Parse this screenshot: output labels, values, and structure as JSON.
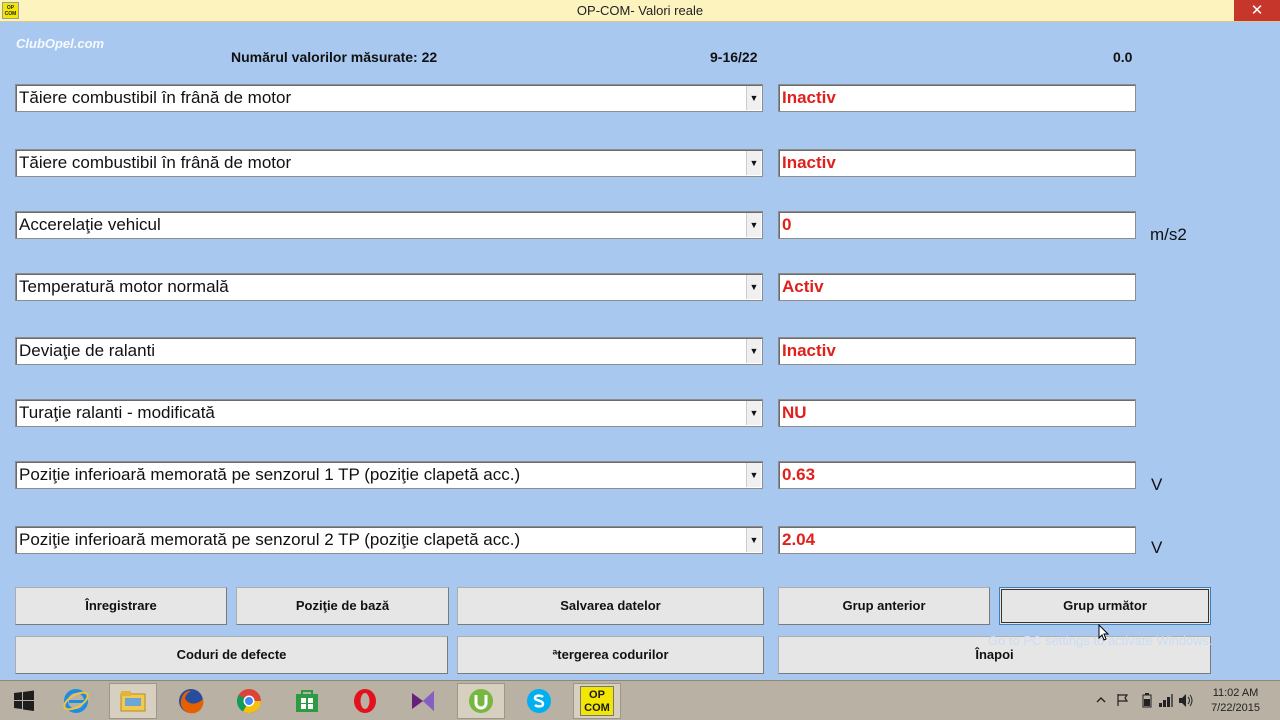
{
  "window": {
    "title": "OP-COM- Valori reale",
    "watermark": "ClubOpel.com",
    "close_glyph": "✕",
    "app_icon_text": "OP COM"
  },
  "header": {
    "count_label": "Numărul valorilor măsurate: 22",
    "range": "9-16/22",
    "value": "0.0"
  },
  "rows": [
    {
      "param": "Tăiere combustibil în frână de motor",
      "value": "Inactiv",
      "unit": ""
    },
    {
      "param": "Tăiere combustibil în frână de motor",
      "value": "Inactiv",
      "unit": ""
    },
    {
      "param": "Accerelaţie vehicul",
      "value": "0",
      "unit": "m/s2"
    },
    {
      "param": "Temperatură  motor normală",
      "value": "Activ",
      "unit": ""
    },
    {
      "param": "Deviaţie de ralanti",
      "value": "Inactiv",
      "unit": ""
    },
    {
      "param": "Turaţie ralanti - modificată",
      "value": "NU",
      "unit": ""
    },
    {
      "param": "Poziţie inferioară memorată pe senzorul 1 TP (poziţie clapetă acc.)",
      "value": "0.63",
      "unit": "V"
    },
    {
      "param": "Poziţie inferioară memorată pe senzorul 2 TP (poziţie clapetă acc.)",
      "value": "2.04",
      "unit": "V"
    }
  ],
  "dropdown_glyph": "▼",
  "buttons": {
    "record": "Înregistrare",
    "base_position": "Poziţie de bază",
    "save_data": "Salvarea datelor",
    "previous_group": "Grup anterior",
    "next_group": "Grup următor",
    "fault_codes": "Coduri de defecte",
    "clear_codes": "ªtergerea codurilor",
    "back": "Înapoi"
  },
  "activation_notice": "Go to PC settings to activate Windows.",
  "taskbar": {
    "items": [
      "windows-start",
      "internet-explorer",
      "file-explorer",
      "firefox",
      "chrome",
      "store",
      "opera",
      "visual-studio",
      "utorrent",
      "skype",
      "opcom"
    ],
    "opcom_label_top": "OP",
    "opcom_label_bottom": "COM",
    "time": "11:02 AM",
    "date": "7/22/2015"
  },
  "colors": {
    "background": "#a8c8f0",
    "value_text": "#e0201c",
    "titlebar": "#fdf3bf",
    "close": "#c7362a"
  }
}
